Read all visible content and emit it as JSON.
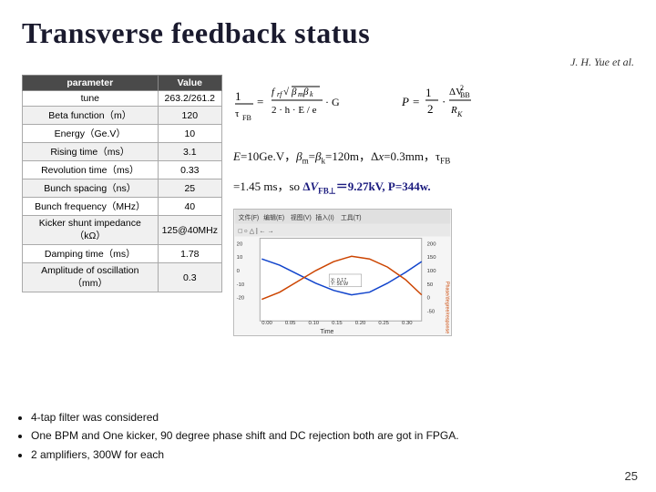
{
  "title": "Transverse feedback status",
  "attribution": "J. H. Yue et al.",
  "table": {
    "headers": [
      "parameter",
      "Value"
    ],
    "rows": [
      [
        "tune",
        "263.2/261.2"
      ],
      [
        "Beta function（m）",
        "120"
      ],
      [
        "Energy（Ge.V）",
        "10"
      ],
      [
        "Rising time（ms）",
        "3.1"
      ],
      [
        "Revolution time（ms）",
        "0.33"
      ],
      [
        "Bunch spacing（ns）",
        "25"
      ],
      [
        "Bunch frequency（MHz）",
        "40"
      ],
      [
        "Kicker shunt impedance（kΩ）",
        "125@40MHz"
      ],
      [
        "Damping time（ms）",
        "1.78"
      ],
      [
        "Amplitude of oscillation（mm）",
        "0.3"
      ]
    ]
  },
  "equation1_label": "E=10Ge.V，β",
  "equation1_sub1": "m",
  "equation1_eq": "=β",
  "equation1_sub2": "k",
  "equation1_val": "=120m，Δx=0.3mm，τ",
  "equation1_sub3": "FB",
  "equation2_label": "=1.45 ms，so ΔV",
  "equation2_sub1": "FB⊥",
  "equation2_eq": "＝9.27kV, P=344w.",
  "bullets": [
    "4-tap filter was considered",
    "One BPM and One kicker, 90 degree phase shift and DC rejection both are got in FPGA.",
    "2 amplifiers, 300W for each"
  ],
  "page_number": "25"
}
